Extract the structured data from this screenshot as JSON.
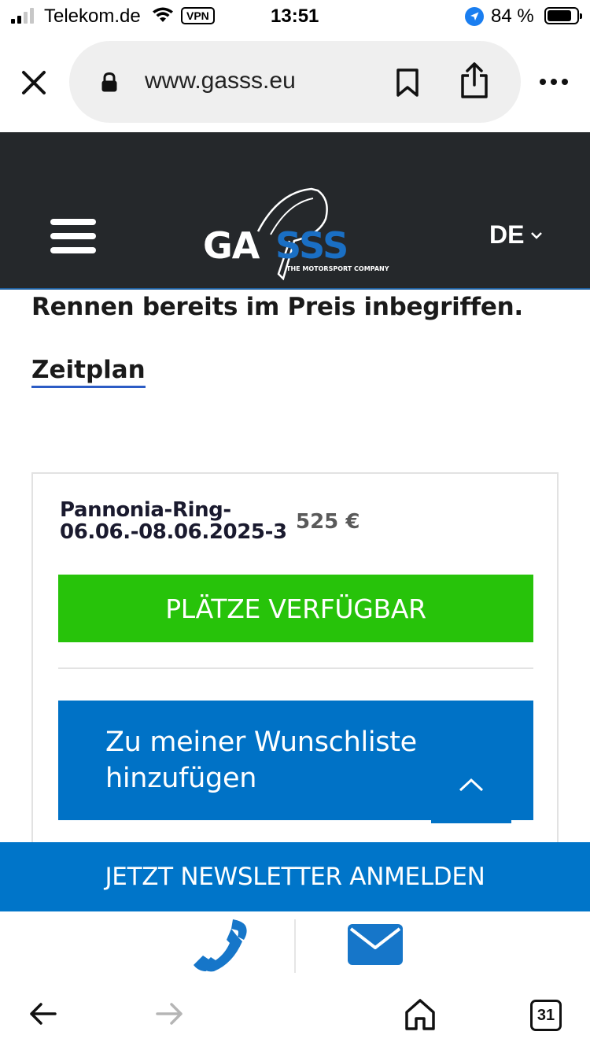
{
  "status_bar": {
    "carrier": "Telekom.de",
    "vpn": "VPN",
    "time": "13:51",
    "battery": "84 %",
    "battery_level": 0.84
  },
  "browser": {
    "url": "www.gasss.eu",
    "icons": [
      "close-icon",
      "lock-icon",
      "bookmark-icon",
      "share-icon",
      "more-icon"
    ]
  },
  "header": {
    "logo_text": "GASSS",
    "logo_tagline": "THE MOTORSPORT COMPANY",
    "language": "DE",
    "colors": {
      "background": "#25282b",
      "accent": "#1a6fc4"
    }
  },
  "content": {
    "text_tail": "Rennen bereits im Preis inbegriffen.",
    "schedule_link": "Zeitplan"
  },
  "event_card": {
    "title_line1": "Pannonia-Ring-",
    "title_line2": "06.06.-08.06.2025-3",
    "price": "525 €",
    "availability_button": "PLÄTZE VERFÜGBAR",
    "wishlist_line1": "Zu meiner Wunschliste",
    "wishlist_line2": "hinzufügen",
    "colors": {
      "available": "#27c30a",
      "wishlist": "#0072c6"
    }
  },
  "newsletter": {
    "label": "JETZT NEWSLETTER ANMELDEN",
    "color": "#0075c9"
  },
  "contact": {
    "icons": [
      "phone-icon",
      "mail-icon"
    ]
  },
  "toolbar": {
    "tabs_count": "31",
    "icons": [
      "back-arrow-icon",
      "forward-arrow-icon",
      "home-icon",
      "tabs-icon"
    ]
  }
}
